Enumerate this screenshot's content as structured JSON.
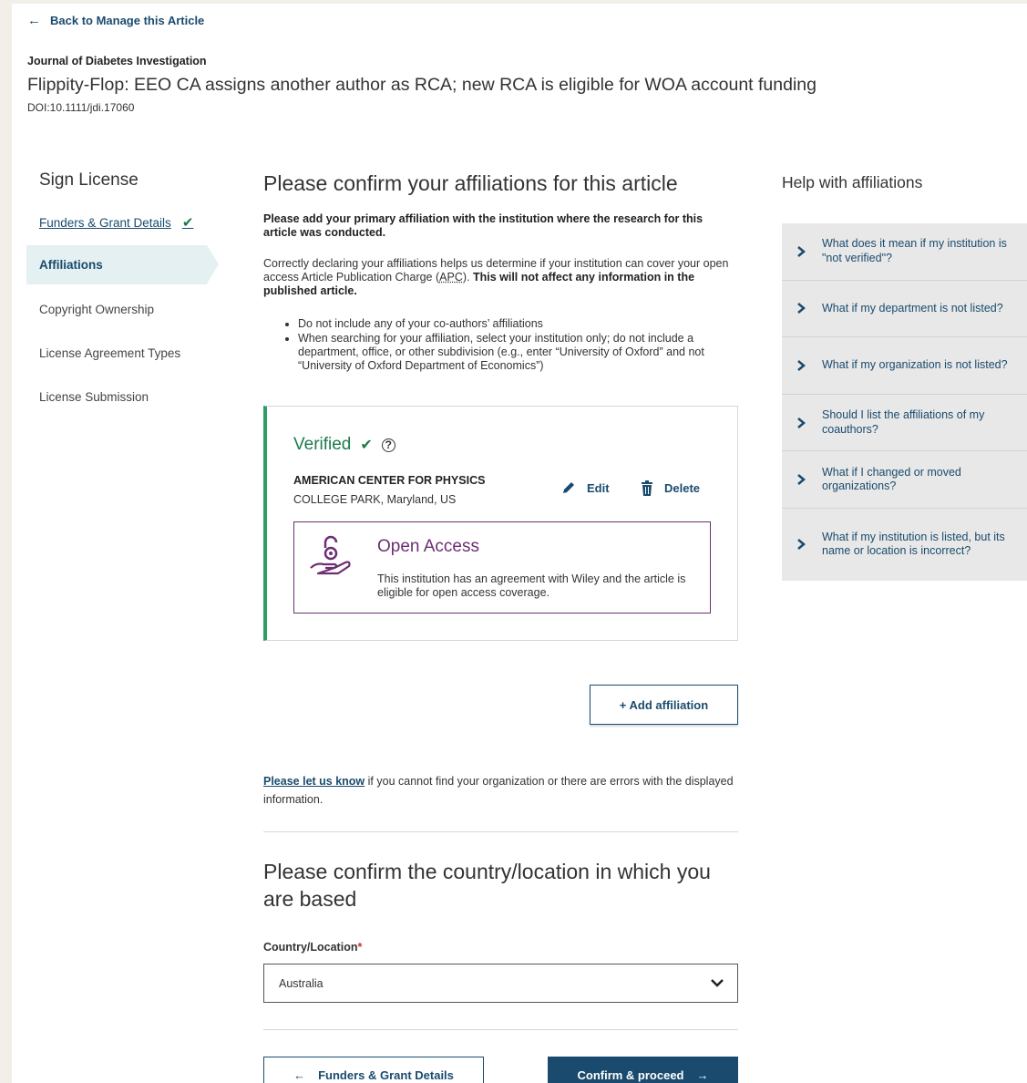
{
  "header": {
    "back_label": "Back to Manage this Article",
    "journal": "Journal of Diabetes Investigation",
    "article_title": "Flippity-Flop: EEO CA assigns another author as RCA; new RCA is eligible for WOA account funding",
    "doi": "DOI:10.1111/jdi.17060"
  },
  "sidebar": {
    "title": "Sign License",
    "items": [
      {
        "label": "Funders & Grant Details",
        "state": "completed"
      },
      {
        "label": "Affiliations",
        "state": "active"
      },
      {
        "label": "Copyright Ownership",
        "state": "pending"
      },
      {
        "label": "License Agreement Types",
        "state": "pending"
      },
      {
        "label": "License Submission",
        "state": "pending"
      }
    ]
  },
  "main": {
    "heading": "Please confirm your affiliations for this article",
    "lead": "Please add your primary affiliation with the institution where the research for this article was conducted.",
    "para_start": "Correctly declaring your affiliations helps us determine if your institution can cover your open access Article Publication Charge (",
    "para_apc": "APC",
    "para_mid": "). ",
    "para_bold": "This will not affect any information in the published article.",
    "bullets": [
      "Do not include any of your co-authors’ affiliations",
      "When searching for your affiliation, select your institution only; do not include a department, office, or other subdivision (e.g., enter “University of Oxford” and not “University of Oxford Department of Economics”)"
    ],
    "affiliation": {
      "status": "Verified",
      "institution": "AMERICAN CENTER FOR PHYSICS",
      "location": "COLLEGE PARK, Maryland, US",
      "edit_label": "Edit",
      "delete_label": "Delete",
      "oa_title": "Open Access",
      "oa_text": "This institution has an agreement with Wiley and the article is eligible for open access coverage."
    },
    "add_affiliation_label": "+ Add affiliation",
    "let_us_know_link": "Please let us know",
    "let_us_know_rest": " if you cannot find your organization or there are errors with the displayed information.",
    "country_heading": "Please confirm the country/location in which you are based",
    "country_label": "Country/Location",
    "country_required": "*",
    "country_value": "Australia",
    "prev_label": "Funders & Grant Details",
    "next_label": "Confirm & proceed"
  },
  "help": {
    "title": "Help with affiliations",
    "items": [
      "What does it mean if my institution is \"not verified\"?",
      "What if my department is not listed?",
      "What if my organization is not listed?",
      "Should I list the affiliations of my coauthors?",
      "What if I changed or moved organizations?",
      "What if my institution is listed, but its name or location is incorrect?"
    ]
  },
  "colors": {
    "primary": "#1a4b6e",
    "verified_green": "#1d7a4c",
    "open_access_purple": "#6c2f73",
    "active_nav_bg": "#e4f0f1"
  }
}
